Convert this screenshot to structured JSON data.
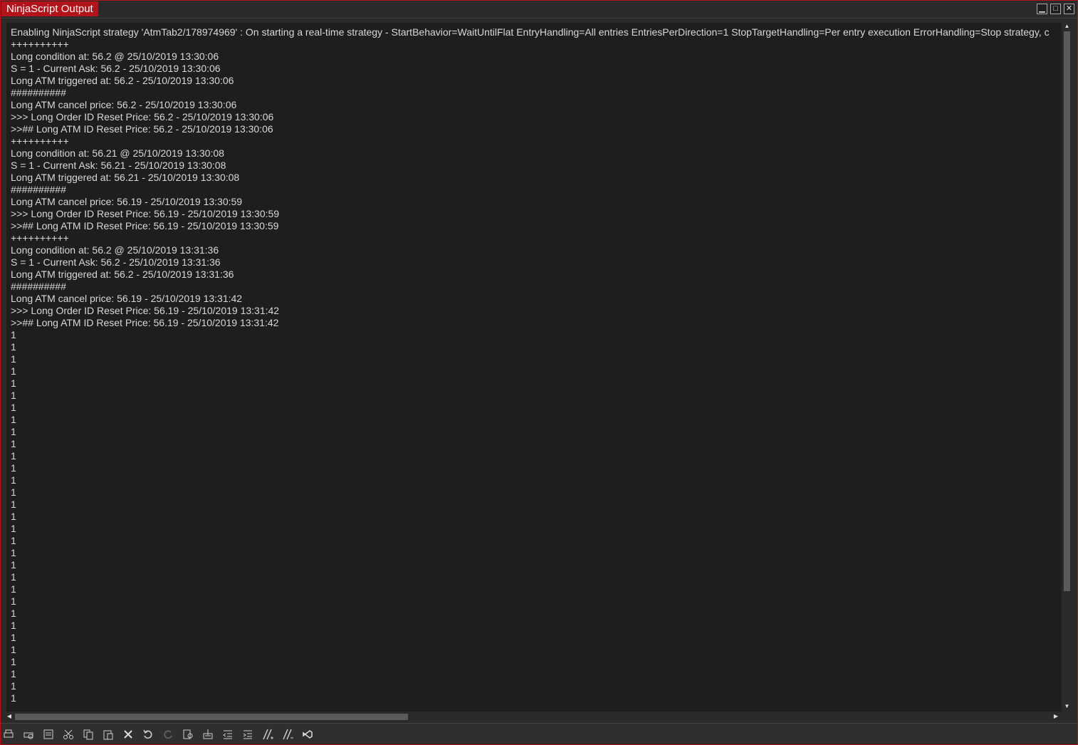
{
  "window": {
    "title": "NinjaScript Output",
    "controls": [
      "minimize-icon",
      "maximize-icon",
      "close-icon"
    ]
  },
  "output": {
    "lines": [
      "Enabling NinjaScript strategy 'AtmTab2/178974969' : On starting a real-time strategy - StartBehavior=WaitUntilFlat EntryHandling=All entries EntriesPerDirection=1 StopTargetHandling=Per entry execution ErrorHandling=Stop strategy, c",
      "++++++++++",
      "Long condition at: 56.2 @ 25/10/2019 13:30:06",
      "S = 1 - Current Ask: 56.2 - 25/10/2019 13:30:06",
      "Long ATM triggered at: 56.2 - 25/10/2019 13:30:06",
      "##########",
      "Long ATM cancel price: 56.2 - 25/10/2019 13:30:06",
      ">>> Long Order ID Reset Price: 56.2 - 25/10/2019 13:30:06",
      ">>## Long ATM ID Reset Price: 56.2 - 25/10/2019 13:30:06",
      "++++++++++",
      "Long condition at: 56.21 @ 25/10/2019 13:30:08",
      "S = 1 - Current Ask: 56.21 - 25/10/2019 13:30:08",
      "Long ATM triggered at: 56.21 - 25/10/2019 13:30:08",
      "##########",
      "Long ATM cancel price: 56.19 - 25/10/2019 13:30:59",
      ">>> Long Order ID Reset Price: 56.19 - 25/10/2019 13:30:59",
      ">>## Long ATM ID Reset Price: 56.19 - 25/10/2019 13:30:59",
      "++++++++++",
      "Long condition at: 56.2 @ 25/10/2019 13:31:36",
      "S = 1 - Current Ask: 56.2 - 25/10/2019 13:31:36",
      "Long ATM triggered at: 56.2 - 25/10/2019 13:31:36",
      "##########",
      "Long ATM cancel price: 56.19 - 25/10/2019 13:31:42",
      ">>> Long Order ID Reset Price: 56.19 - 25/10/2019 13:31:42",
      ">>## Long ATM ID Reset Price: 56.19 - 25/10/2019 13:31:42",
      "1",
      "1",
      "1",
      "1",
      "1",
      "1",
      "1",
      "1",
      "1",
      "1",
      "1",
      "1",
      "1",
      "1",
      "1",
      "1",
      "1",
      "1",
      "1",
      "1",
      "1",
      "1",
      "1",
      "1",
      "1",
      "1",
      "1",
      "1",
      "1",
      "1",
      "1"
    ]
  },
  "toolbar": {
    "buttons": [
      "print-icon",
      "print-preview-icon",
      "page-setup-icon",
      "cut-icon",
      "copy-icon",
      "paste-icon",
      "clear-icon",
      "undo-icon",
      "redo-icon",
      "find-icon",
      "save-icon",
      "outdent-icon",
      "indent-icon",
      "comment-icon",
      "uncomment-icon",
      "visual-studio-icon"
    ]
  },
  "colors": {
    "accent": "#b3141b",
    "background": "#1e1e1e",
    "text": "#d8d8d8"
  }
}
